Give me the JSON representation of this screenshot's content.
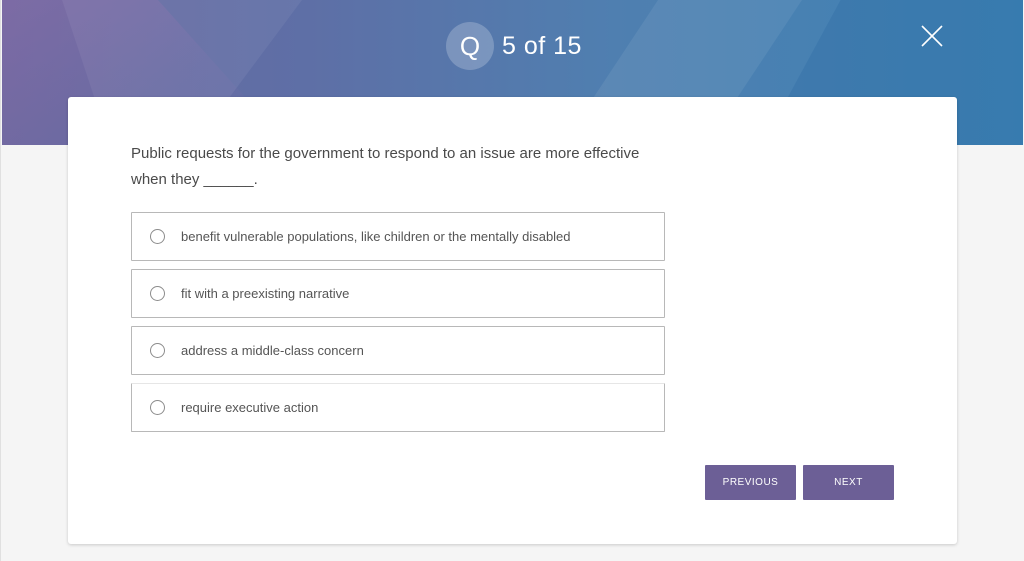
{
  "header": {
    "badge_letter": "Q",
    "progress": "5 of 15",
    "close_icon": "close-icon"
  },
  "question": {
    "text": "Public requests for the government to respond to an issue are more effective when they ______."
  },
  "options": [
    {
      "label": "benefit vulnerable populations, like children or the mentally disabled"
    },
    {
      "label": "fit with a preexisting narrative"
    },
    {
      "label": "address a middle-class concern"
    },
    {
      "label": "require executive action"
    }
  ],
  "nav": {
    "previous_label": "PREVIOUS",
    "next_label": "NEXT"
  },
  "colors": {
    "button": "#6c5f96",
    "banner_start": "#6a689f",
    "banner_end": "#3f83b5"
  }
}
